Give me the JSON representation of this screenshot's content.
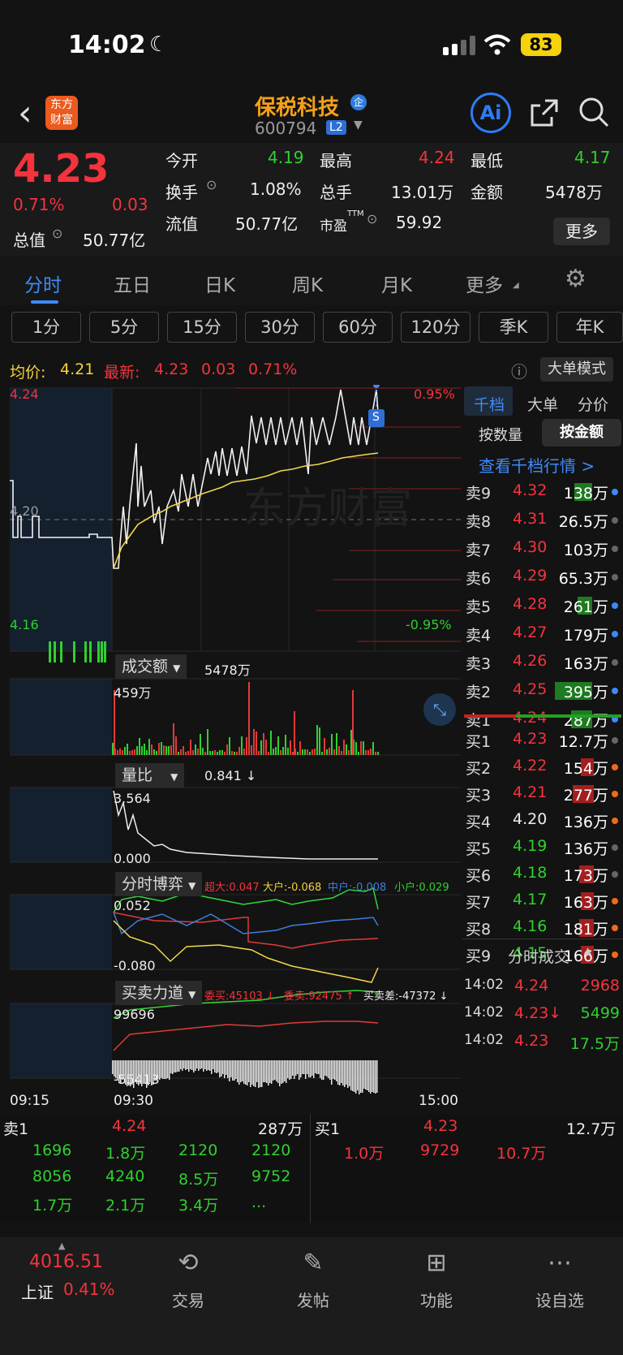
{
  "status_bar": {
    "time": "14:02",
    "battery": "83"
  },
  "header": {
    "stock_name": "保税科技",
    "badge": "企",
    "code": "600794",
    "level": "L2",
    "ai": "Ai"
  },
  "quote": {
    "price": "4.23",
    "pct": "0.71%",
    "change": "0.03",
    "open_label": "今开",
    "open": "4.19",
    "high_label": "最高",
    "high": "4.24",
    "low_label": "最低",
    "low": "4.17",
    "turnover_label": "换手",
    "turnover": "1.08%",
    "volume_label": "总手",
    "volume": "13.01万",
    "amount_label": "金额",
    "amount": "5478万",
    "mktcap_label": "总值",
    "mktcap": "50.77亿",
    "float_label": "流值",
    "float": "50.77亿",
    "pe_label": "市盈",
    "pe_sup": "TTM",
    "pe": "59.92",
    "more": "更多"
  },
  "tabs": [
    {
      "label": "分时"
    },
    {
      "label": "五日"
    },
    {
      "label": "日K"
    },
    {
      "label": "周K"
    },
    {
      "label": "月K"
    },
    {
      "label": "更多"
    }
  ],
  "periods": [
    "1分",
    "5分",
    "15分",
    "30分",
    "60分",
    "120分",
    "季K",
    "年K"
  ],
  "avg": {
    "avg_label": "均价:",
    "avg": "4.21",
    "latest_label": "最新:",
    "latest": "4.23",
    "change": "0.03",
    "pct": "0.71%",
    "mode_button": "大单模式"
  },
  "chart_labels": {
    "price_top": "4.24",
    "price_mid": "4.20",
    "price_bottom": "4.16",
    "pct_top": "0.95%",
    "pct_bottom": "-0.95%",
    "amount_title": "成交额",
    "amount_value": "5478万",
    "amount_max": "459万",
    "ratio_title": "量比",
    "ratio_value": "0.841 ↓",
    "ratio_max": "3.564",
    "ratio_min": "0.000",
    "game_title": "分时博弈",
    "game_super": "超大:0.047",
    "game_big": "大户:-0.068",
    "game_mid": "中户:-0.008",
    "game_small": "小户:0.029",
    "game_max": "0.052",
    "game_min": "-0.080",
    "force_title": "买卖力道",
    "force_buy": "委买:45103 ↓",
    "force_sell": "委卖:92475 ↑",
    "force_diff": "买卖差:-47372 ↓",
    "force_max": "99696",
    "force_min": "-55413",
    "time_start": "09:15",
    "time_open": "09:30",
    "time_end": "15:00",
    "s_marker": "S"
  },
  "orderbook": {
    "tabs": [
      "千档",
      "大单",
      "分价"
    ],
    "sub_tabs": [
      "按数量",
      "按金额"
    ],
    "link": "查看千档行情 >",
    "sells": [
      {
        "label": "卖9",
        "price": "4.32",
        "vol": "138万"
      },
      {
        "label": "卖8",
        "price": "4.31",
        "vol": "26.5万"
      },
      {
        "label": "卖7",
        "price": "4.30",
        "vol": "103万"
      },
      {
        "label": "卖6",
        "price": "4.29",
        "vol": "65.3万"
      },
      {
        "label": "卖5",
        "price": "4.28",
        "vol": "261万"
      },
      {
        "label": "卖4",
        "price": "4.27",
        "vol": "179万"
      },
      {
        "label": "卖3",
        "price": "4.26",
        "vol": "163万"
      },
      {
        "label": "卖2",
        "price": "4.25",
        "vol": "395万"
      },
      {
        "label": "卖1",
        "price": "4.24",
        "vol": "287万"
      }
    ],
    "buys": [
      {
        "label": "买1",
        "price": "4.23",
        "vol": "12.7万"
      },
      {
        "label": "买2",
        "price": "4.22",
        "vol": "154万"
      },
      {
        "label": "买3",
        "price": "4.21",
        "vol": "277万"
      },
      {
        "label": "买4",
        "price": "4.20",
        "vol": "136万"
      },
      {
        "label": "买5",
        "price": "4.19",
        "vol": "136万"
      },
      {
        "label": "买6",
        "price": "4.18",
        "vol": "173万"
      },
      {
        "label": "买7",
        "price": "4.17",
        "vol": "163万"
      },
      {
        "label": "买8",
        "price": "4.16",
        "vol": "181万"
      },
      {
        "label": "买9",
        "price": "4.15",
        "vol": "166万"
      }
    ],
    "trades_title": "分时成交",
    "trades": [
      {
        "time": "14:02",
        "price": "4.24",
        "vol": "2968"
      },
      {
        "time": "14:02",
        "price": "4.23↓",
        "vol": "5499"
      },
      {
        "time": "14:02",
        "price": "4.23",
        "vol": "17.5万"
      }
    ]
  },
  "bottom_book": {
    "sell_label": "卖1",
    "sell_price": "4.24",
    "sell_vol": "287万",
    "buy_label": "买1",
    "buy_price": "4.23",
    "buy_vol": "12.7万",
    "sell_orders": [
      "1696",
      "1.8万",
      "2120",
      "2120",
      "8056",
      "4240",
      "8.5万",
      "9752",
      "1.7万",
      "2.1万",
      "3.4万",
      "..."
    ],
    "buy_orders": [
      "1.0万",
      "9729",
      "10.7万"
    ]
  },
  "nav": {
    "index_value": "4016.51",
    "index_name": "上证",
    "index_pct": "0.41%",
    "items": [
      {
        "label": "交易"
      },
      {
        "label": "发帖"
      },
      {
        "label": "功能"
      },
      {
        "label": "设自选"
      }
    ]
  }
}
